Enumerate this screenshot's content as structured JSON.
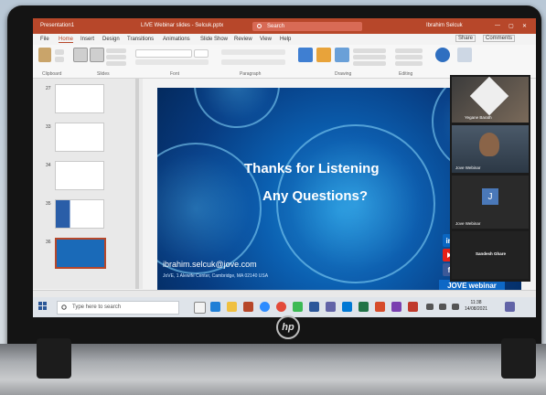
{
  "window": {
    "app_title": "Presentation1",
    "doc_title": "LIVE Webinar slides - Selcuk.pptx",
    "search_placeholder": "Search",
    "user_name": "Ibrahim Selcuk"
  },
  "ribbon": {
    "tabs": [
      "File",
      "Home",
      "Insert",
      "Design",
      "Transitions",
      "Animations",
      "Slide Show",
      "Review",
      "View",
      "Help"
    ],
    "active_tab": "Home",
    "share_label": "Share",
    "comments_label": "Comments",
    "groups": [
      "Clipboard",
      "Slides",
      "Font",
      "Paragraph",
      "Drawing",
      "Editing"
    ]
  },
  "slides_panel": {
    "numbers": [
      "27",
      "33",
      "34",
      "35",
      "36"
    ]
  },
  "slide": {
    "line1": "Thanks for Listening",
    "line2": "Any Questions?",
    "email": "ibrahim.selcuk@jove.com",
    "address": "JoVE, 1 Alewife Center, Cambridge, MA 02140 USA",
    "social": [
      "in",
      "f"
    ],
    "logo": "JOVE webinar"
  },
  "video_panel": {
    "participants": [
      {
        "name": "Yegane Barath"
      },
      {
        "name": "Jove Webinar"
      },
      {
        "name": "Jove Webinar",
        "initial": "J"
      },
      {
        "name": "Sandesh Ghare"
      }
    ]
  },
  "taskbar": {
    "search_placeholder": "Type here to search",
    "time": "11:38",
    "date": "14/08/2021"
  },
  "laptop": {
    "brand": "hp"
  },
  "colors": {
    "accent": "#b7472a",
    "slide_blue": "#0b5fb0",
    "linkedin": "#0a66c2",
    "youtube": "#e62117",
    "facebook": "#3b5998"
  }
}
